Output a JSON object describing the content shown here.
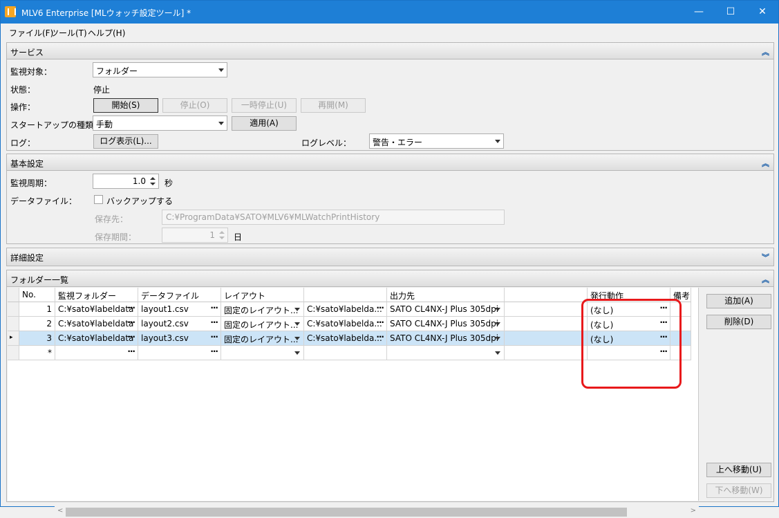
{
  "window": {
    "title": "MLV6 Enterprise [MLウォッチ設定ツール] *",
    "minimize": "—",
    "maximize": "☐",
    "close": "✕"
  },
  "menu": [
    "ファイル(F)",
    "ツール(T)",
    "ヘルプ(H)"
  ],
  "service": {
    "title": "サービス",
    "collapse_glyph": "︽",
    "monitor_target_label": "監視対象：",
    "monitor_target_value": "フォルダー",
    "status_label": "状態：",
    "status_value": "停止",
    "operation_label": "操作：",
    "start": "開始(S)",
    "stop": "停止(O)",
    "pause": "一時停止(U)",
    "resume": "再開(M)",
    "startup_label": "スタートアップの種類：",
    "startup_value": "手動",
    "apply": "適用(A)",
    "log_label": "ログ：",
    "log_button": "ログ表示(L)...",
    "log_level_label": "ログレベル：",
    "log_level_value": "警告・エラー"
  },
  "basic": {
    "title": "基本設定",
    "collapse_glyph": "︽",
    "interval_label": "監視周期：",
    "interval_value": "1.0",
    "interval_unit": "秒",
    "datafile_label": "データファイル：",
    "backup_label": "バックアップする",
    "save_to_label": "保存先：",
    "save_to_value": "C:¥ProgramData¥SATO¥MLV6¥MLWatchPrintHistory",
    "retention_label": "保存期間：",
    "retention_value": "1",
    "retention_unit": "日"
  },
  "detail": {
    "title": "詳細設定",
    "expand_glyph": "︾"
  },
  "folders": {
    "title": "フォルダー一覧",
    "collapse_glyph": "︽",
    "columns": [
      "No.",
      "監視フォルダー",
      "データファイル",
      "レイアウト",
      "",
      "出力先",
      "",
      "発行動作",
      "備考"
    ],
    "rows": [
      {
        "no": "1",
        "folder": "C:¥sato¥labeldata",
        "datafile": "layout1.csv",
        "layout": "固定のレイアウト...",
        "layout_path": "C:¥sato¥labelda...",
        "output": "SATO CL4NX-J Plus 305dpi",
        "action": "(なし)"
      },
      {
        "no": "2",
        "folder": "C:¥sato¥labeldata",
        "datafile": "layout2.csv",
        "layout": "固定のレイアウト...",
        "layout_path": "C:¥sato¥labelda...",
        "output": "SATO CL4NX-J Plus 305dpi",
        "action": "(なし)"
      },
      {
        "no": "3",
        "folder": "C:¥sato¥labeldata",
        "datafile": "layout3.csv",
        "layout": "固定のレイアウト...",
        "layout_path": "C:¥sato¥labelda...",
        "output": "SATO CL4NX-J Plus 305dpi",
        "action": "(なし)"
      }
    ],
    "new_row_marker": "*",
    "current_row_marker": "▸",
    "ellipsis": "···",
    "add": "追加(A)",
    "delete": "削除(D)",
    "move_up": "上へ移動(U)",
    "move_down": "下へ移動(W)"
  }
}
